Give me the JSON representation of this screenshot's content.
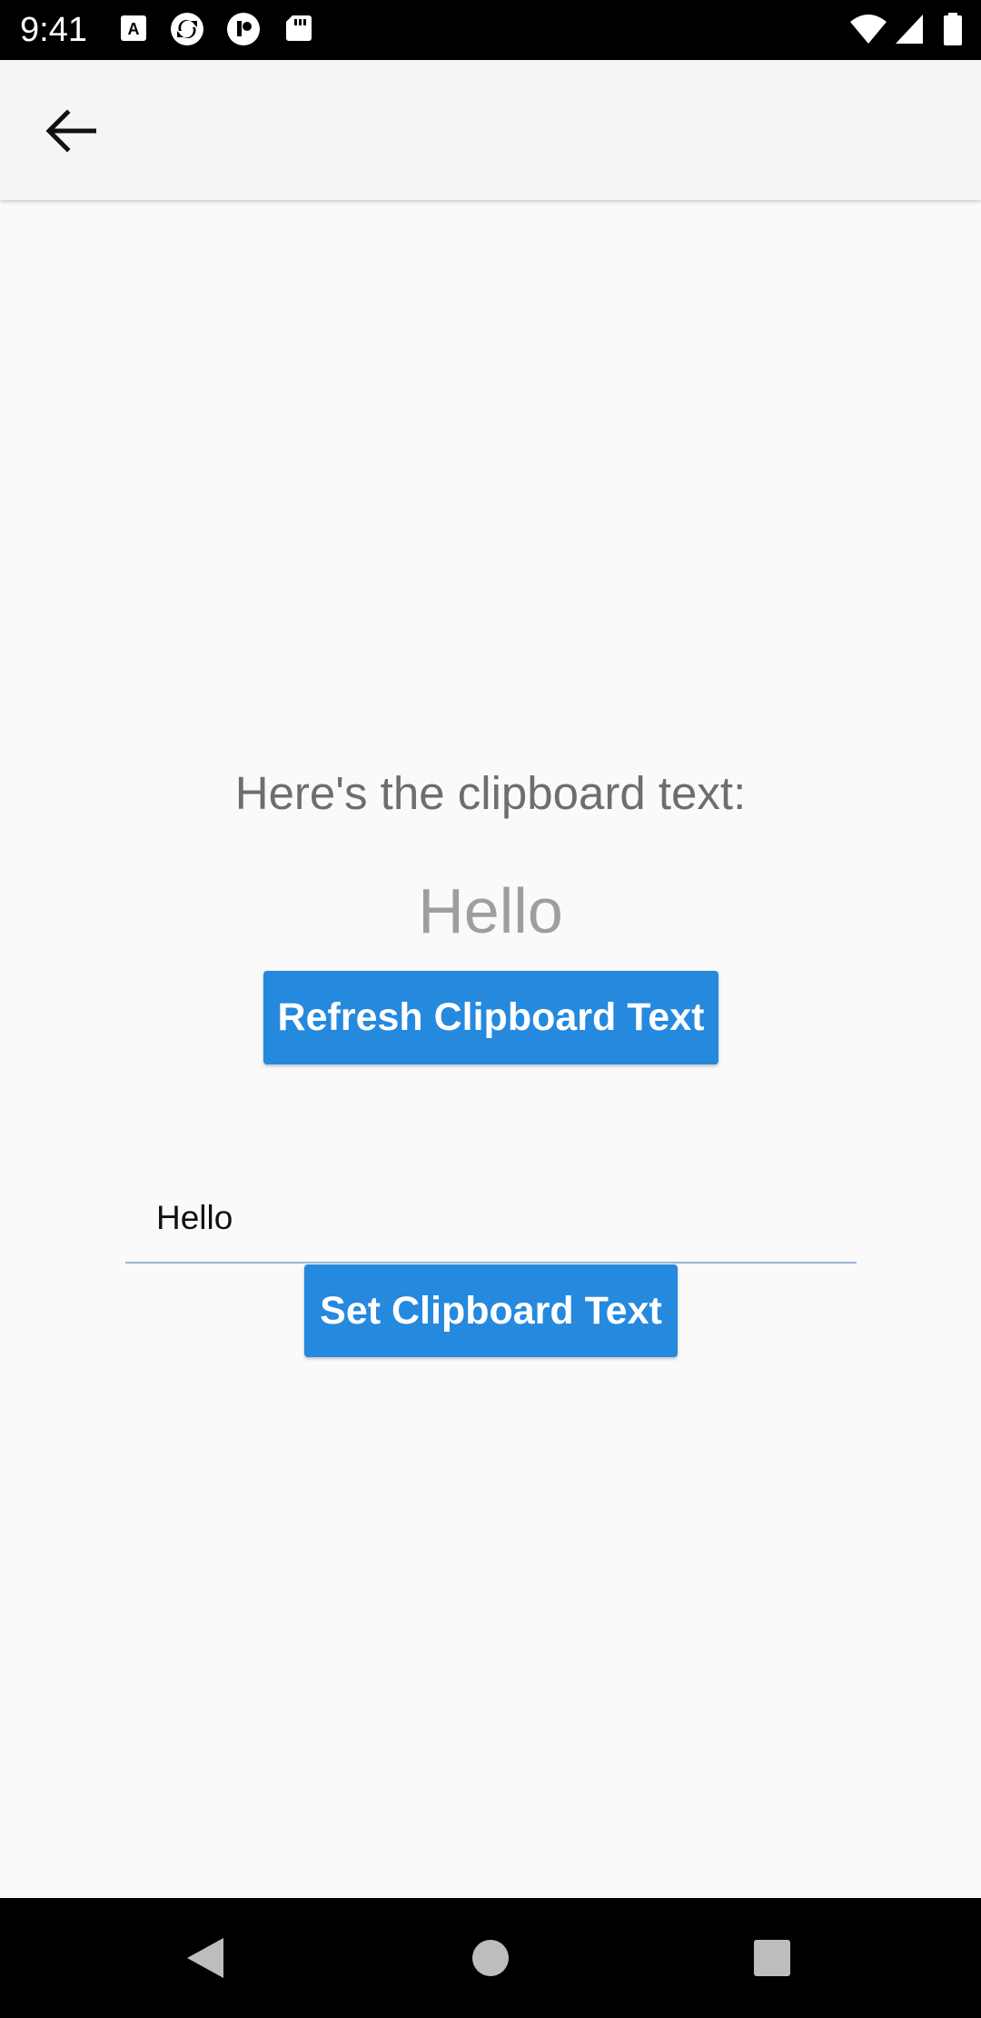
{
  "status_bar": {
    "time": "9:41",
    "left_icons": [
      "a-box-icon",
      "sync-icon",
      "app-icon",
      "sd-card-icon"
    ],
    "right_icons": [
      "wifi-icon",
      "signal-icon",
      "battery-icon"
    ]
  },
  "app_bar": {
    "back_icon": "arrow-back-icon"
  },
  "main": {
    "clipboard_label": "Here's the clipboard text:",
    "clipboard_value": "Hello",
    "refresh_button_label": "Refresh Clipboard Text",
    "input_value": "Hello",
    "set_button_label": "Set Clipboard Text"
  },
  "nav_bar": {
    "buttons": [
      "back-triangle-icon",
      "home-circle-icon",
      "recents-square-icon"
    ]
  },
  "colors": {
    "accent": "#2589de",
    "status_bar": "#000000",
    "app_bar": "#f5f5f5",
    "background": "#fafafa",
    "underline": "#98b4d6"
  }
}
